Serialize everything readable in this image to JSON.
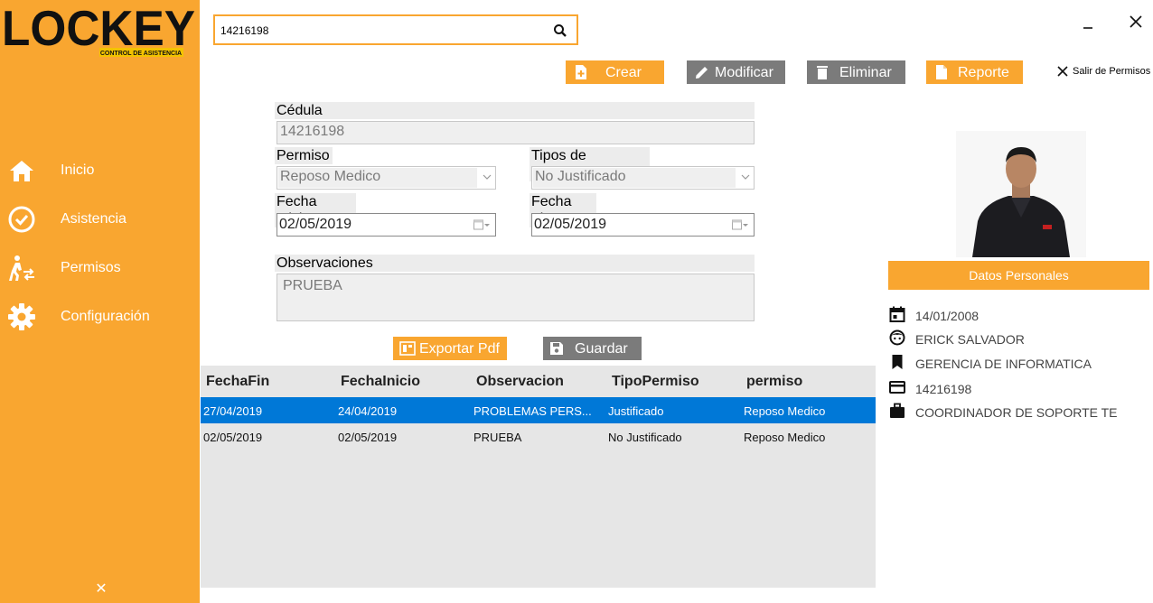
{
  "logo": {
    "word": "LOCKEY",
    "tagline": "CONTROL DE ASISTENCIA"
  },
  "sidebar": {
    "items": [
      {
        "label": "Inicio",
        "icon": "home-icon"
      },
      {
        "label": "Asistencia",
        "icon": "check-circle-icon"
      },
      {
        "label": "Permisos",
        "icon": "walking-person-icon"
      },
      {
        "label": "Configuración",
        "icon": "gear-icon"
      }
    ]
  },
  "search": {
    "value": "14216198"
  },
  "toolbar": {
    "crear": "Crear",
    "modificar": "Modificar",
    "eliminar": "Eliminar",
    "reporte": "Reporte",
    "salir": "Salir de Permisos"
  },
  "form": {
    "cedula_label": "Cédula",
    "cedula_value": "14216198",
    "permiso_label": "Permiso",
    "permiso_value": "Reposo Medico",
    "tipos_label": "Tipos de permisos",
    "tipos_value": "No Justificado",
    "fecha_inicio_label": "Fecha Inicio",
    "fecha_inicio_value": "02/05/2019",
    "fecha_fin_label": "Fecha Fin",
    "fecha_fin_value": "02/05/2019",
    "observaciones_label": "Observaciones",
    "observaciones_value": "PRUEBA"
  },
  "actions": {
    "exportar": "Exportar Pdf",
    "guardar": "Guardar"
  },
  "grid": {
    "columns": [
      "FechaFin",
      "FechaInicio",
      "Observacion",
      "TipoPermiso",
      "permiso"
    ],
    "rows": [
      [
        "27/04/2019",
        "24/04/2019",
        "PROBLEMAS PERS...",
        "Justificado",
        "Reposo Medico"
      ],
      [
        "02/05/2019",
        "02/05/2019",
        "PRUEBA",
        "No Justificado",
        "Reposo Medico"
      ]
    ],
    "selected_row": 0
  },
  "personal": {
    "title": "Datos Personales",
    "fecha": "14/01/2008",
    "nombre": "ERICK SALVADOR",
    "departamento": "GERENCIA DE INFORMATICA",
    "cedula": "14216198",
    "cargo": "COORDINADOR DE SOPORTE TE"
  },
  "colors": {
    "accent": "#f9a630",
    "button_grey": "#7b7b7b",
    "selected_row": "#0078d7"
  }
}
